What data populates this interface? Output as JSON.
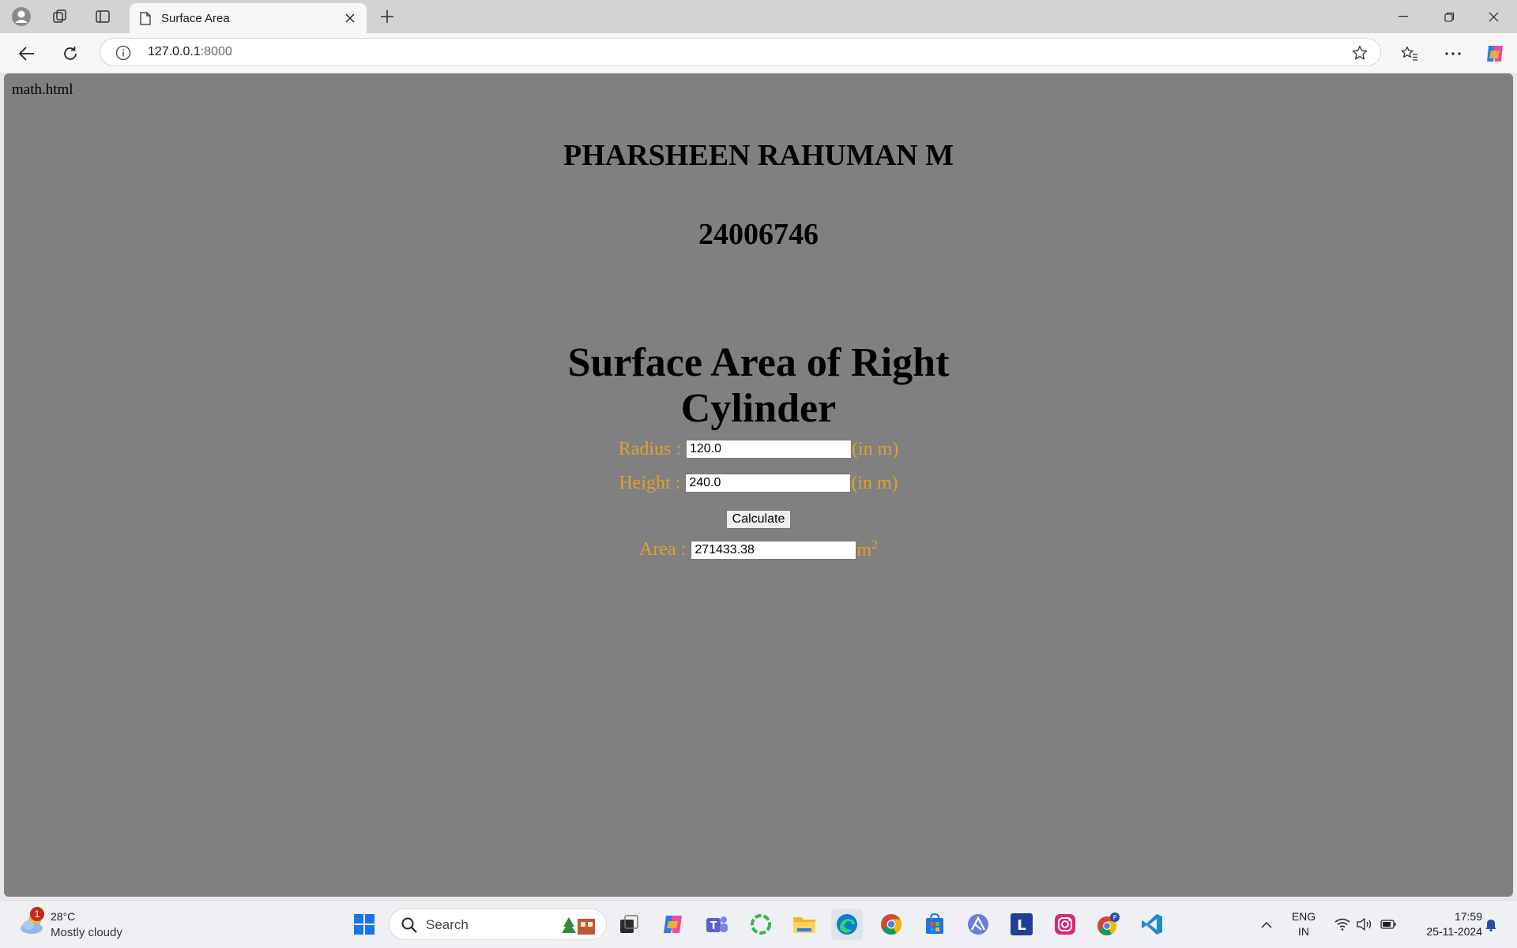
{
  "browser": {
    "tab_title": "Surface Area",
    "address_host": "127.0.0.1",
    "address_port": ":8000"
  },
  "page": {
    "filename": "math.html",
    "author": "PHARSHEEN RAHUMAN M",
    "reg_no": "24006746",
    "heading_line1": "Surface Area of Right",
    "heading_line2": "Cylinder",
    "radius_label": "Radius : ",
    "radius_value": "120.0",
    "radius_unit": "(in m)",
    "height_label": "Height : ",
    "height_value": "240.0",
    "height_unit": "(in m)",
    "calculate_label": "Calculate",
    "area_label": "Area : ",
    "area_value": "271433.38",
    "area_unit": "m",
    "area_exponent": "2",
    "label_color": "#e0a030",
    "background_color": "#808080"
  },
  "taskbar": {
    "weather_badge": "1",
    "weather_temp": "28°C",
    "weather_desc": "Mostly cloudy",
    "search_label": "Search",
    "lang_line1": "ENG",
    "lang_line2": "IN",
    "time": "17:59",
    "date": "25-11-2024",
    "icons": [
      "task-view-icon",
      "copilot-icon",
      "teams-icon",
      "circle-app-icon",
      "file-explorer-icon",
      "edge-icon",
      "chrome-icon",
      "store-icon",
      "vector-app-icon",
      "l-app-icon",
      "instagram-icon",
      "chrome-profile-icon",
      "vscode-icon"
    ]
  }
}
